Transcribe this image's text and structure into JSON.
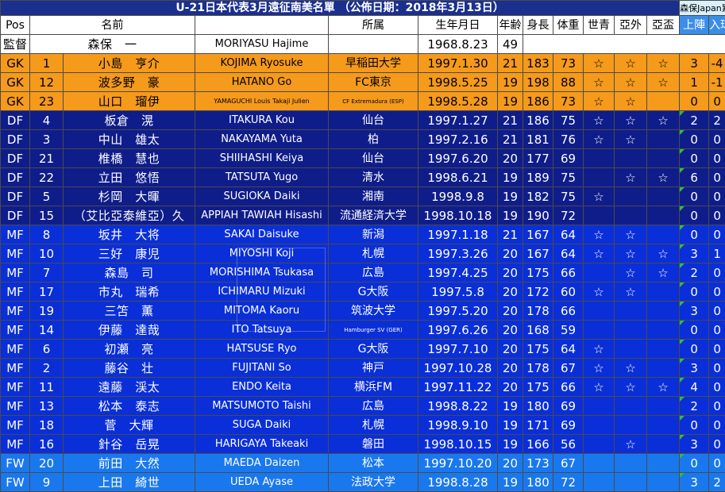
{
  "title": "U-21日本代表3月遠征南美名單 （公佈日期：2018年3月13日）",
  "credit": "森保Japan累積",
  "headers": [
    "Pos",
    "名前",
    "",
    "所属",
    "生年月日",
    "年齢",
    "身長",
    "体重",
    "世青",
    "亞外",
    "亞盃",
    "上陣",
    "入球"
  ],
  "coach": {
    "pos": "監督",
    "name": "森保　一",
    "roman": "MORIYASU Hajime",
    "club": "",
    "dob": "1968.8.23",
    "age": "49"
  },
  "players": [
    {
      "group": "gk",
      "pos": "GK",
      "no": "1",
      "name": "小島　亨介",
      "roman": "KOJIMA Ryosuke",
      "club": "早稲田大学",
      "dob": "1997.1.30",
      "age": "21",
      "height": "183",
      "weight": "73",
      "wy": "☆",
      "ao": "☆",
      "ac": "☆",
      "caps": "3",
      "goals": "-4"
    },
    {
      "group": "gk",
      "pos": "GK",
      "no": "12",
      "name": "波多野　豪",
      "roman": "HATANO Go",
      "club": "FC東京",
      "dob": "1998.5.25",
      "age": "19",
      "height": "198",
      "weight": "88",
      "wy": "☆",
      "ao": "☆",
      "ac": "☆",
      "caps": "1",
      "goals": "-1"
    },
    {
      "group": "gk",
      "pos": "GK",
      "no": "23",
      "name": "山口　瑠伊",
      "roman": "YAMAGUCHI Louis Takaji Julien",
      "club": "CF Extremadura (ESP)",
      "dob": "1998.5.28",
      "age": "19",
      "height": "186",
      "weight": "73",
      "wy": "☆",
      "ao": "☆",
      "ac": "",
      "caps": "0",
      "goals": "0",
      "smallRoman": true,
      "smallClub": true
    },
    {
      "group": "df",
      "pos": "DF",
      "no": "4",
      "name": "板倉　滉",
      "roman": "ITAKURA Kou",
      "club": "仙台",
      "dob": "1997.1.27",
      "age": "21",
      "height": "186",
      "weight": "75",
      "wy": "☆",
      "ao": "☆",
      "ac": "☆",
      "caps": "2",
      "goals": "2",
      "flag": true
    },
    {
      "group": "df",
      "pos": "DF",
      "no": "3",
      "name": "中山　雄太",
      "roman": "NAKAYAMA Yuta",
      "club": "柏",
      "dob": "1997.2.16",
      "age": "21",
      "height": "181",
      "weight": "76",
      "wy": "☆",
      "ao": "☆",
      "ac": "",
      "caps": "0",
      "goals": "0",
      "flag": true
    },
    {
      "group": "df",
      "pos": "DF",
      "no": "21",
      "name": "椎橋　慧也",
      "roman": "SHIIHASHI Keiya",
      "club": "仙台",
      "dob": "1997.6.20",
      "age": "20",
      "height": "177",
      "weight": "69",
      "wy": "",
      "ao": "",
      "ac": "",
      "caps": "0",
      "goals": "0",
      "flag": true
    },
    {
      "group": "df",
      "pos": "DF",
      "no": "22",
      "name": "立田　悠悟",
      "roman": "TATSUTA Yugo",
      "club": "清水",
      "dob": "1998.6.21",
      "age": "19",
      "height": "189",
      "weight": "75",
      "wy": "",
      "ao": "☆",
      "ac": "☆",
      "caps": "6",
      "goals": "0",
      "flag": true
    },
    {
      "group": "df",
      "pos": "DF",
      "no": "5",
      "name": "杉岡　大暉",
      "roman": "SUGIOKA Daiki",
      "club": "湘南",
      "dob": "1998.9.8",
      "age": "19",
      "height": "182",
      "weight": "75",
      "wy": "☆",
      "ao": "",
      "ac": "",
      "caps": "0",
      "goals": "0",
      "flag": true
    },
    {
      "group": "df",
      "pos": "DF",
      "no": "15",
      "name": "（艾比亞泰維亞）久",
      "roman": "APPIAH TAWIAH Hisashi",
      "club": "流通経済大学",
      "dob": "1998.10.18",
      "age": "19",
      "height": "190",
      "weight": "72",
      "wy": "",
      "ao": "",
      "ac": "",
      "caps": "0",
      "goals": "0",
      "flag": true
    },
    {
      "group": "mf",
      "pos": "MF",
      "no": "8",
      "name": "坂井　大将",
      "roman": "SAKAI Daisuke",
      "club": "新潟",
      "dob": "1997.1.18",
      "age": "21",
      "height": "167",
      "weight": "64",
      "wy": "☆",
      "ao": "☆",
      "ac": "",
      "caps": "0",
      "goals": "0",
      "flag": true
    },
    {
      "group": "mf",
      "pos": "MF",
      "no": "10",
      "name": "三好　康児",
      "roman": "MIYOSHI Koji",
      "club": "札幌",
      "dob": "1997.3.26",
      "age": "20",
      "height": "167",
      "weight": "64",
      "wy": "☆",
      "ao": "☆",
      "ac": "☆",
      "caps": "3",
      "goals": "1",
      "flag": true
    },
    {
      "group": "mf",
      "pos": "MF",
      "no": "7",
      "name": "森島　司",
      "roman": "MORISHIMA Tsukasa",
      "club": "広島",
      "dob": "1997.4.25",
      "age": "20",
      "height": "175",
      "weight": "66",
      "wy": "",
      "ao": "☆",
      "ac": "☆",
      "caps": "2",
      "goals": "0",
      "flag": true
    },
    {
      "group": "mf",
      "pos": "MF",
      "no": "17",
      "name": "市丸　瑞希",
      "roman": "ICHIMARU Mizuki",
      "club": "G大阪",
      "dob": "1997.5.8",
      "age": "20",
      "height": "172",
      "weight": "60",
      "wy": "☆",
      "ao": "☆",
      "ac": "",
      "caps": "0",
      "goals": "0",
      "flag": true
    },
    {
      "group": "mf",
      "pos": "MF",
      "no": "19",
      "name": "三笘　薫",
      "roman": "MITOMA Kaoru",
      "club": "筑波大学",
      "dob": "1997.5.20",
      "age": "20",
      "height": "178",
      "weight": "66",
      "wy": "",
      "ao": "",
      "ac": "",
      "caps": "3",
      "goals": "0",
      "flag": true
    },
    {
      "group": "mf",
      "pos": "MF",
      "no": "14",
      "name": "伊藤　達哉",
      "roman": "ITO Tatsuya",
      "club": "Hamburger SV (GER)",
      "dob": "1997.6.26",
      "age": "20",
      "height": "168",
      "weight": "59",
      "wy": "",
      "ao": "",
      "ac": "",
      "caps": "0",
      "goals": "0",
      "smallClub": true,
      "flag": true
    },
    {
      "group": "mf",
      "pos": "MF",
      "no": "6",
      "name": "初瀬　亮",
      "roman": "HATSUSE Ryo",
      "club": "G大阪",
      "dob": "1997.7.10",
      "age": "20",
      "height": "175",
      "weight": "64",
      "wy": "☆",
      "ao": "",
      "ac": "",
      "caps": "0",
      "goals": "0",
      "flag": true
    },
    {
      "group": "mf",
      "pos": "MF",
      "no": "2",
      "name": "藤谷　壮",
      "roman": "FUJITANI So",
      "club": "神戸",
      "dob": "1997.10.28",
      "age": "20",
      "height": "178",
      "weight": "67",
      "wy": "☆",
      "ao": "☆",
      "ac": "",
      "caps": "3",
      "goals": "0",
      "flag": true
    },
    {
      "group": "mf",
      "pos": "MF",
      "no": "11",
      "name": "遠藤　渓太",
      "roman": "ENDO Keita",
      "club": "横浜FM",
      "dob": "1997.11.22",
      "age": "20",
      "height": "175",
      "weight": "66",
      "wy": "☆",
      "ao": "☆",
      "ac": "☆",
      "caps": "4",
      "goals": "0",
      "flag": true
    },
    {
      "group": "mf",
      "pos": "MF",
      "no": "13",
      "name": "松本　泰志",
      "roman": "MATSUMOTO Taishi",
      "club": "広島",
      "dob": "1998.8.22",
      "age": "19",
      "height": "180",
      "weight": "69",
      "wy": "",
      "ao": "",
      "ac": "",
      "caps": "2",
      "goals": "0",
      "flag": true
    },
    {
      "group": "mf",
      "pos": "MF",
      "no": "18",
      "name": "菅　大輝",
      "roman": "SUGA Daiki",
      "club": "札幌",
      "dob": "1998.9.10",
      "age": "19",
      "height": "171",
      "weight": "69",
      "wy": "",
      "ao": "",
      "ac": "",
      "caps": "0",
      "goals": "0",
      "flag": true
    },
    {
      "group": "mf",
      "pos": "MF",
      "no": "16",
      "name": "針谷　岳晃",
      "roman": "HARIGAYA Takeaki",
      "club": "磐田",
      "dob": "1998.10.15",
      "age": "19",
      "height": "166",
      "weight": "56",
      "wy": "",
      "ao": "☆",
      "ac": "",
      "caps": "3",
      "goals": "0",
      "flag": true
    },
    {
      "group": "fw",
      "pos": "FW",
      "no": "20",
      "name": "前田　大然",
      "roman": "MAEDA Daizen",
      "club": "松本",
      "dob": "1997.10.20",
      "age": "20",
      "height": "173",
      "weight": "67",
      "wy": "",
      "ao": "",
      "ac": "",
      "caps": "0",
      "goals": "0",
      "flag": true
    },
    {
      "group": "fw",
      "pos": "FW",
      "no": "9",
      "name": "上田　綺世",
      "roman": "UEDA Ayase",
      "club": "法政大学",
      "dob": "1998.8.28",
      "age": "19",
      "height": "180",
      "weight": "72",
      "wy": "",
      "ao": "",
      "ac": "",
      "caps": "3",
      "goals": "2",
      "flag": true
    }
  ],
  "colors": {
    "title": "#1b2f8f",
    "gk": "#f59a1a",
    "df": "#0f1d8a",
    "mf": "#0a2fd8",
    "fw": "#1a78ee",
    "headHighlight": "#3b8ee8"
  }
}
